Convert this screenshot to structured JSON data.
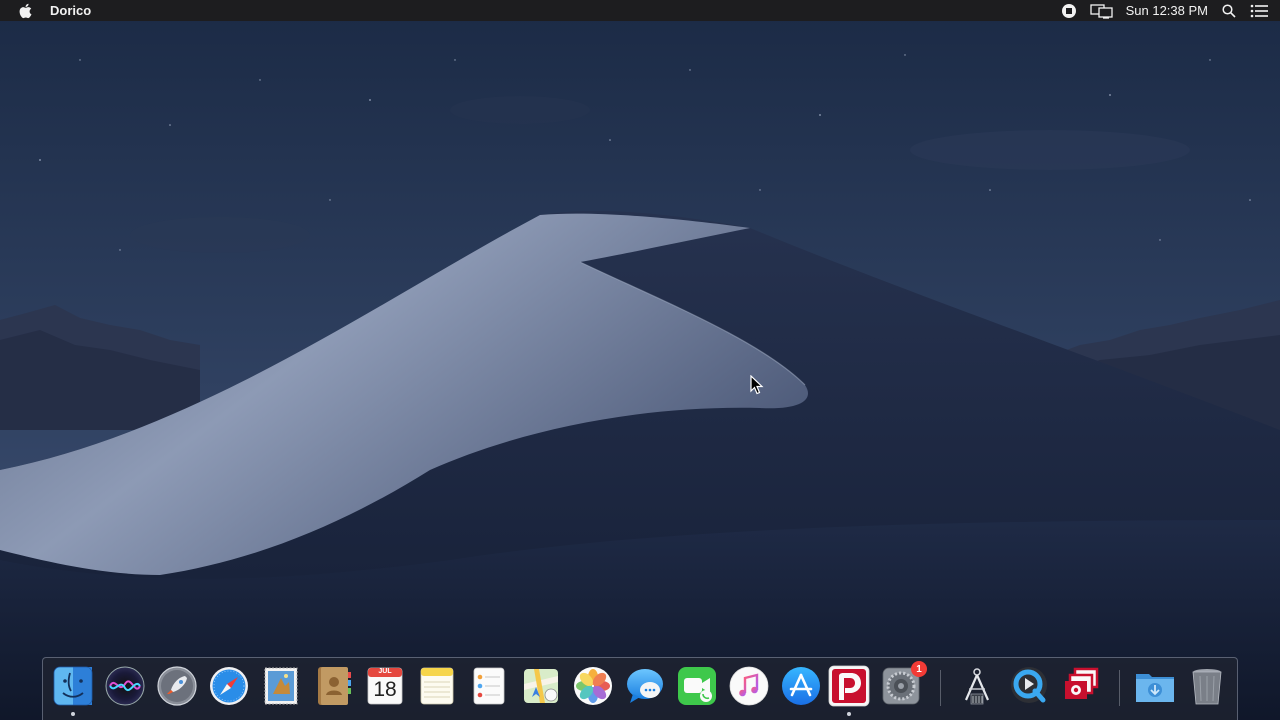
{
  "menubar": {
    "app_name": "Dorico",
    "clock": "Sun 12:38 PM",
    "icons": [
      "apple-logo",
      "record-icon",
      "display-mirror-icon",
      "spotlight-search-icon",
      "notification-center-icon"
    ]
  },
  "dock": {
    "items": [
      {
        "id": "finder",
        "icon": "finder-icon",
        "running": true
      },
      {
        "id": "siri",
        "icon": "siri-icon"
      },
      {
        "id": "launchpad",
        "icon": "launchpad-rocket-icon"
      },
      {
        "id": "safari",
        "icon": "safari-compass-icon"
      },
      {
        "id": "mail",
        "icon": "mail-stamp-icon"
      },
      {
        "id": "contacts",
        "icon": "contacts-book-icon"
      },
      {
        "id": "calendar",
        "icon": "calendar-icon",
        "month": "JUL",
        "day": "18"
      },
      {
        "id": "notes",
        "icon": "notes-icon"
      },
      {
        "id": "reminders",
        "icon": "reminders-icon"
      },
      {
        "id": "maps",
        "icon": "maps-icon"
      },
      {
        "id": "photos",
        "icon": "photos-flower-icon"
      },
      {
        "id": "messages",
        "icon": "messages-bubble-icon"
      },
      {
        "id": "facetime",
        "icon": "facetime-camera-icon"
      },
      {
        "id": "itunes",
        "icon": "itunes-note-icon"
      },
      {
        "id": "app-store",
        "icon": "app-store-icon"
      },
      {
        "id": "dorico",
        "icon": "dorico-icon",
        "running": true
      },
      {
        "id": "system-preferences",
        "icon": "system-preferences-gear-icon",
        "badge": "1"
      },
      {
        "id": "dock-separator-1",
        "separator": true
      },
      {
        "id": "fetch-tool",
        "icon": "compass-caliper-icon"
      },
      {
        "id": "quicktime",
        "icon": "quicktime-icon"
      },
      {
        "id": "photo-booth",
        "icon": "photo-stack-icon"
      },
      {
        "id": "dock-separator-2",
        "separator": true
      },
      {
        "id": "downloads",
        "icon": "downloads-folder-icon"
      },
      {
        "id": "trash",
        "icon": "trash-icon"
      }
    ]
  },
  "colors": {
    "menubar_bg": "#1d1d1f",
    "sky_top": "#1b2a45",
    "sky_bottom": "#3a4c6c",
    "dune_light": "#8a96b0",
    "dune_shadow": "#1c2742",
    "badge": "#f23b36",
    "dorico_red": "#c8102e"
  }
}
